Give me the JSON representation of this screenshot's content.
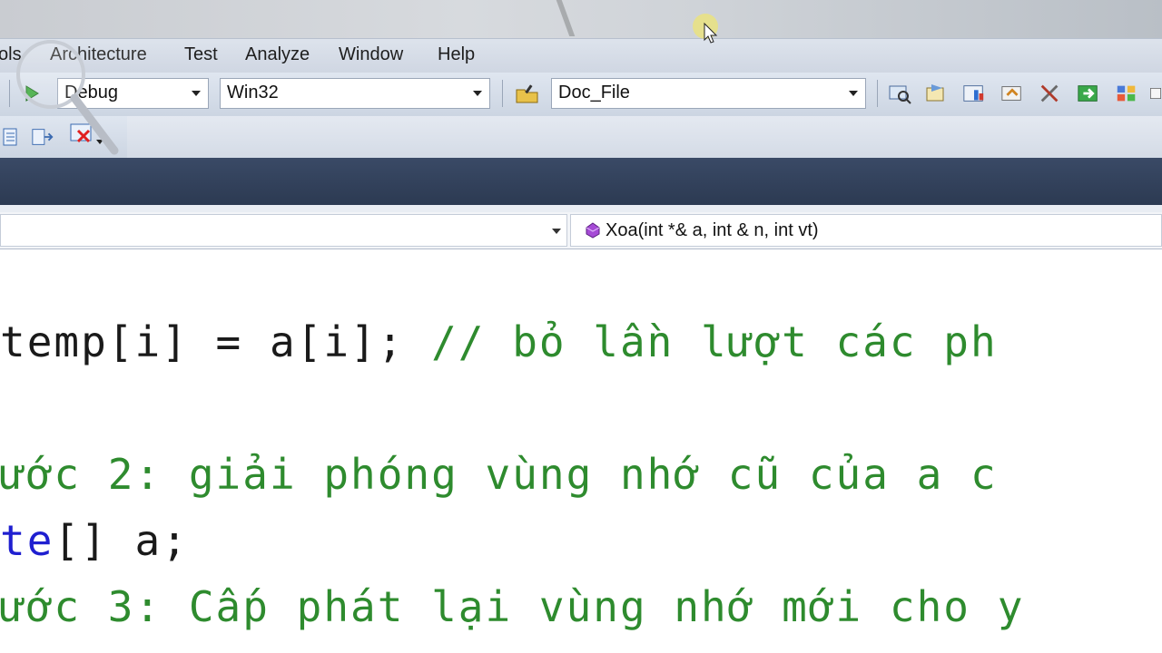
{
  "menu": {
    "items": [
      {
        "label": "ols"
      },
      {
        "label": "Architecture"
      },
      {
        "label": "Test"
      },
      {
        "label": "Analyze"
      },
      {
        "label": "Window"
      },
      {
        "label": "Help"
      }
    ]
  },
  "toolbar": {
    "configuration": "Debug",
    "platform": "Win32",
    "find_target": "Doc_File"
  },
  "navbar": {
    "member": "Xoa(int *& a, int & n, int vt)"
  },
  "code": {
    "line1_code": "temp[i] = a[i]; ",
    "line1_comment": "// bỏ lần lượt các ph",
    "line2_comment": "ước 2: giải phóng vùng nhớ cũ của a c",
    "line3_keyword": "te",
    "line3_code": "[] a;",
    "line4_comment": "ước 3: Cấp phát lại vùng nhớ mới cho y"
  },
  "colors": {
    "comment": "#2e8b2e",
    "keyword": "#1f1fd0",
    "text": "#1a1a1a",
    "dark_band": "#2c3a52"
  }
}
